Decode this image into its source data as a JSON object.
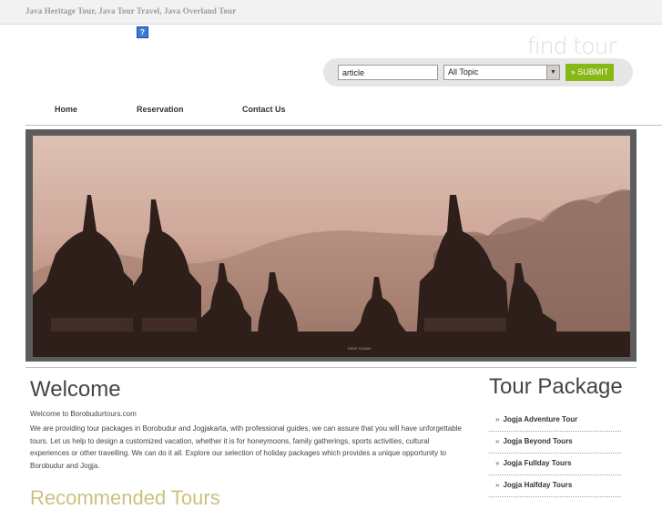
{
  "topbar": {
    "tagline": "Java Heritage Tour, Java Tour Travel, Java Overland Tour"
  },
  "help": {
    "icon": "question-mark-icon",
    "glyph": "?"
  },
  "search": {
    "heading": "find tour",
    "query_value": "article",
    "topic_selected": "All Topic",
    "submit_label": "» SUBMIT"
  },
  "nav": {
    "items": [
      "Home",
      "Reservation",
      "Contact Us"
    ]
  },
  "hero": {
    "watermark": "KEEP CLEAN"
  },
  "welcome": {
    "title": "Welcome",
    "subtitle": "Welcome to Borobudurtours.com",
    "body": "We are providing tour packages in Borobudur and Jogjakarta, with professional guides, we can assure that you will have unforgettable tours. Let us help to design a customized vacation, whether it is for honeymoons, family gatherings, sports activities, cultural experiences or other travelling. We can do it all. Explore our selection of holiday packages which provides a unique opportunity to Borobudur and Jogja."
  },
  "sidebar": {
    "title": "Tour Package",
    "items": [
      {
        "bullet": "»",
        "label": "Jogja Adventure Tour"
      },
      {
        "bullet": "»",
        "label": "Jogja Beyond Tours"
      },
      {
        "bullet": "»",
        "label": "Jogja Fullday Tours"
      },
      {
        "bullet": "»",
        "label": "Jogja Halfday Tours"
      }
    ]
  },
  "colors": {
    "accent": "#86b816",
    "muted_heading": "#c9c37e",
    "frame": "#5c5c5c"
  }
}
